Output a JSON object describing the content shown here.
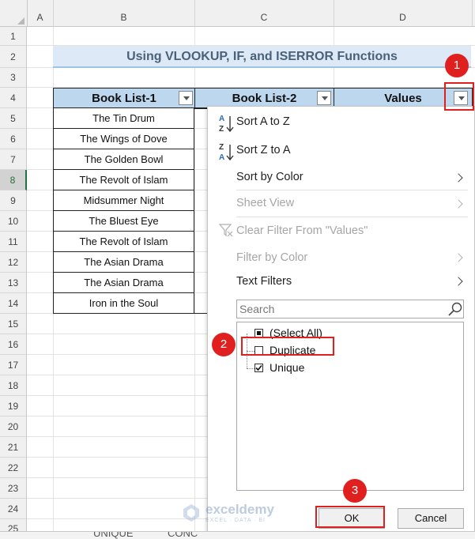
{
  "columns": [
    "A",
    "B",
    "C",
    "D"
  ],
  "rows": [
    "1",
    "2",
    "3",
    "4",
    "5",
    "6",
    "7",
    "8",
    "9",
    "10",
    "11",
    "12",
    "13",
    "14",
    "15",
    "16",
    "17",
    "18",
    "19",
    "20",
    "21",
    "22",
    "23",
    "24",
    "25"
  ],
  "title": "Using VLOOKUP, IF, and ISERROR Functions",
  "table": {
    "headers": [
      "Book List-1",
      "Book List-2",
      "Values"
    ],
    "book_list_1": [
      "The Tin Drum",
      "The Wings of Dove",
      "The Golden Bowl",
      "The Revolt of Islam",
      "Midsummer Night",
      "The Bluest Eye",
      "The Revolt of Islam",
      "The Asian Drama",
      "The Asian Drama",
      "Iron in the Soul"
    ]
  },
  "menu": {
    "sort_az": "Sort A to Z",
    "sort_za": "Sort Z to A",
    "sort_by_color": "Sort by Color",
    "sheet_view": "Sheet View",
    "clear_filter": "Clear Filter From \"Values\"",
    "filter_by_color": "Filter by Color",
    "text_filters": "Text Filters",
    "search_placeholder": "Search",
    "list": [
      {
        "label": "(Select All)",
        "state": "partial"
      },
      {
        "label": "Duplicate",
        "state": "unchecked"
      },
      {
        "label": "Unique",
        "state": "checked"
      }
    ],
    "ok": "OK",
    "cancel": "Cancel"
  },
  "badges": [
    "1",
    "2",
    "3"
  ],
  "sheet_tabs": [
    "UNIQUE",
    "CONC"
  ],
  "watermark": {
    "name": "exceldemy",
    "tagline": "EXCEL · DATA · BI"
  },
  "colors": {
    "header_fill": "#bdd7ee",
    "title_fill": "#dde9f6",
    "annotation": "#e0201f",
    "selected_row": "#217346"
  }
}
